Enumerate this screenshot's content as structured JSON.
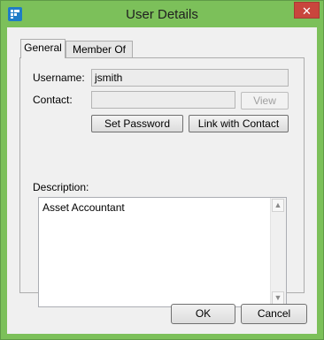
{
  "window": {
    "title": "User Details",
    "close_glyph": "✕"
  },
  "tabs": [
    {
      "label": "General",
      "active": true
    },
    {
      "label": "Member Of",
      "active": false
    }
  ],
  "form": {
    "username_label": "Username:",
    "username_value": "jsmith",
    "contact_label": "Contact:",
    "contact_value": "",
    "view_button": "View",
    "set_password_button": "Set Password",
    "link_contact_button": "Link with Contact",
    "description_label": "Description:",
    "description_value": "Asset Accountant"
  },
  "scrollbar": {
    "up": "▲",
    "down": "▼"
  },
  "footer": {
    "ok_button": "OK",
    "cancel_button": "Cancel"
  }
}
